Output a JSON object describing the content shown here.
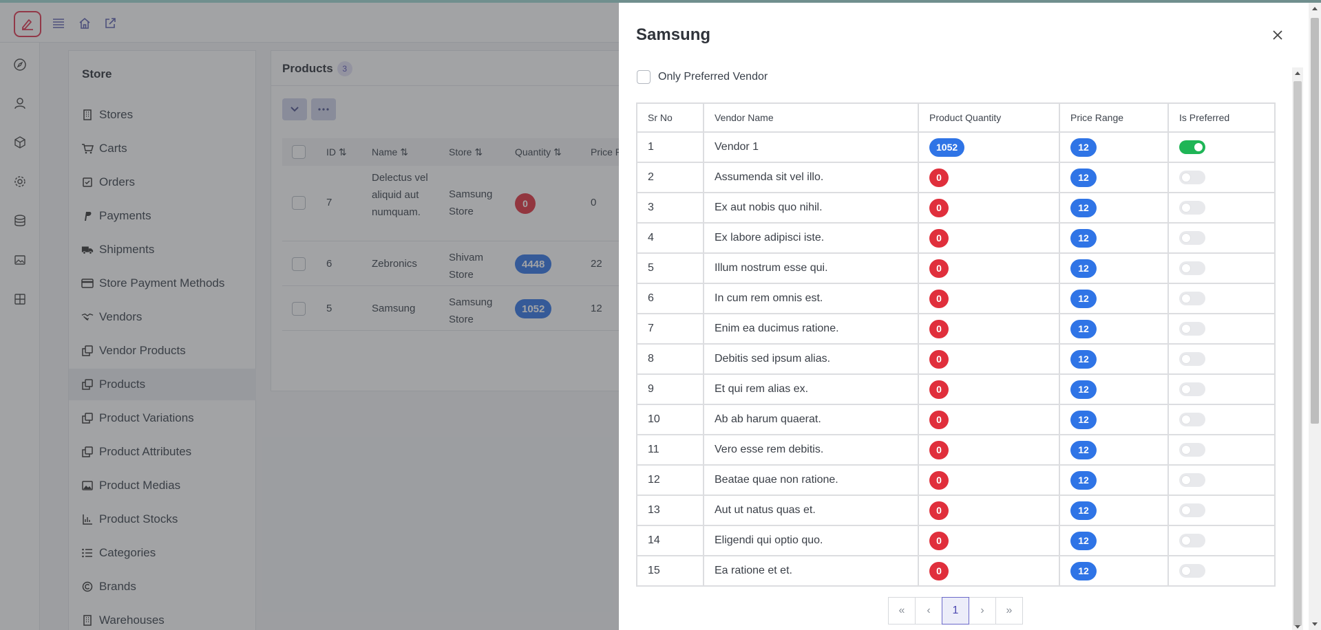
{
  "sidebar": {
    "title": "Store",
    "items": [
      {
        "label": "Stores",
        "icon": "building-icon"
      },
      {
        "label": "Carts",
        "icon": "cart-icon"
      },
      {
        "label": "Orders",
        "icon": "checkbox-icon"
      },
      {
        "label": "Payments",
        "icon": "paypal-icon"
      },
      {
        "label": "Shipments",
        "icon": "truck-icon"
      },
      {
        "label": "Store Payment Methods",
        "icon": "credit-card-icon"
      },
      {
        "label": "Vendors",
        "icon": "handshake-icon"
      },
      {
        "label": "Vendor Products",
        "icon": "copy-icon"
      },
      {
        "label": "Products",
        "icon": "copy-icon",
        "active": true
      },
      {
        "label": "Product Variations",
        "icon": "copy-icon"
      },
      {
        "label": "Product Attributes",
        "icon": "copy-icon"
      },
      {
        "label": "Product Medias",
        "icon": "image-icon"
      },
      {
        "label": "Product Stocks",
        "icon": "bar-chart-icon"
      },
      {
        "label": "Categories",
        "icon": "list-icon"
      },
      {
        "label": "Brands",
        "icon": "copyright-icon"
      },
      {
        "label": "Warehouses",
        "icon": "building-icon"
      }
    ]
  },
  "products_panel": {
    "title": "Products",
    "count": "3",
    "columns": [
      "ID",
      "Name",
      "Store",
      "Quantity",
      "Price R"
    ],
    "rows": [
      {
        "id": "7",
        "name": "Delectus vel aliquid aut numquam.",
        "store": "Samsung Store",
        "quantity": "0",
        "price": "0"
      },
      {
        "id": "6",
        "name": "Zebronics",
        "store": "Shivam Store",
        "quantity": "4448",
        "price": "22"
      },
      {
        "id": "5",
        "name": "Samsung",
        "store": "Samsung Store",
        "quantity": "1052",
        "price": "12"
      }
    ]
  },
  "drawer": {
    "title": "Samsung",
    "filter_label": "Only Preferred Vendor",
    "columns": [
      "Sr No",
      "Vendor Name",
      "Product Quantity",
      "Price Range",
      "Is Preferred"
    ],
    "rows": [
      {
        "sr": "1",
        "vendor": "Vendor 1",
        "qty": "1052",
        "price": "12",
        "preferred": true
      },
      {
        "sr": "2",
        "vendor": "Assumenda sit vel illo.",
        "qty": "0",
        "price": "12",
        "preferred": false
      },
      {
        "sr": "3",
        "vendor": "Ex aut nobis quo nihil.",
        "qty": "0",
        "price": "12",
        "preferred": false
      },
      {
        "sr": "4",
        "vendor": "Ex labore adipisci iste.",
        "qty": "0",
        "price": "12",
        "preferred": false
      },
      {
        "sr": "5",
        "vendor": "Illum nostrum esse qui.",
        "qty": "0",
        "price": "12",
        "preferred": false
      },
      {
        "sr": "6",
        "vendor": "In cum rem omnis est.",
        "qty": "0",
        "price": "12",
        "preferred": false
      },
      {
        "sr": "7",
        "vendor": "Enim ea ducimus ratione.",
        "qty": "0",
        "price": "12",
        "preferred": false
      },
      {
        "sr": "8",
        "vendor": "Debitis sed ipsum alias.",
        "qty": "0",
        "price": "12",
        "preferred": false
      },
      {
        "sr": "9",
        "vendor": "Et qui rem alias ex.",
        "qty": "0",
        "price": "12",
        "preferred": false
      },
      {
        "sr": "10",
        "vendor": "Ab ab harum quaerat.",
        "qty": "0",
        "price": "12",
        "preferred": false
      },
      {
        "sr": "11",
        "vendor": "Vero esse rem debitis.",
        "qty": "0",
        "price": "12",
        "preferred": false
      },
      {
        "sr": "12",
        "vendor": "Beatae quae non ratione.",
        "qty": "0",
        "price": "12",
        "preferred": false
      },
      {
        "sr": "13",
        "vendor": "Aut ut natus quas et.",
        "qty": "0",
        "price": "12",
        "preferred": false
      },
      {
        "sr": "14",
        "vendor": "Eligendi qui optio quo.",
        "qty": "0",
        "price": "12",
        "preferred": false
      },
      {
        "sr": "15",
        "vendor": "Ea ratione et et.",
        "qty": "0",
        "price": "12",
        "preferred": false
      }
    ],
    "pagination": {
      "first": "«",
      "prev": "‹",
      "current": "1",
      "next": "›",
      "last": "»"
    }
  },
  "colors": {
    "accent": "#6a68c9",
    "danger": "#e02f3c",
    "primary": "#2f74e6",
    "success": "#1fb556",
    "brand": "#e0334d"
  }
}
